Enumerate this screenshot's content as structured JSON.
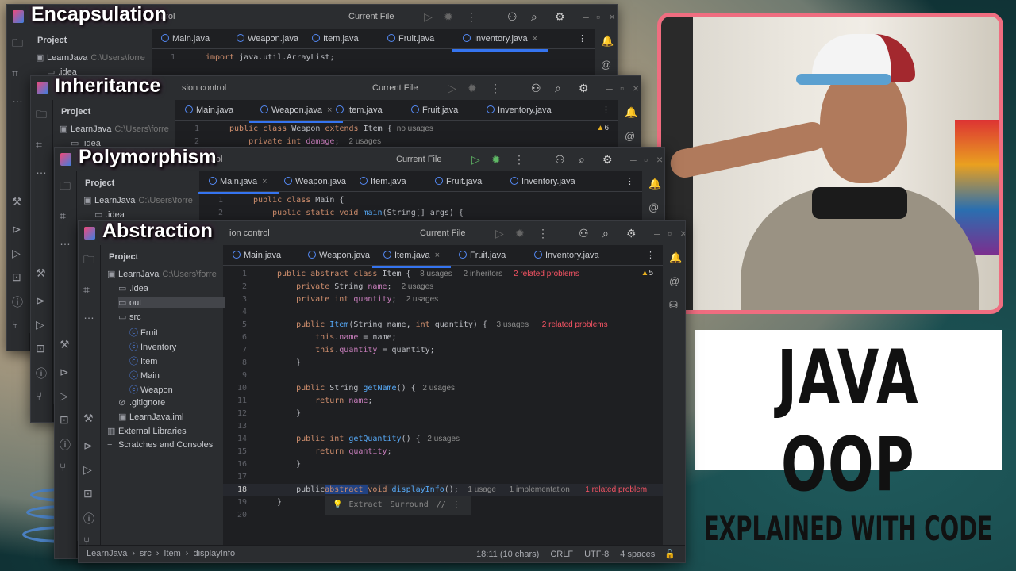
{
  "windows": [
    {
      "label": "Encapsulation",
      "vcs": "ntrol",
      "run_config": "Current File",
      "tabs": [
        "Main.java",
        "Weapon.java",
        "Item.java",
        "Fruit.java",
        "Inventory.java"
      ],
      "active_tab": 4,
      "project_label": "Project",
      "root": "LearnJava",
      "root_path": "C:\\Users\\forre",
      "code": [
        [
          [
            "import ",
            "kw"
          ],
          [
            "java.util.ArrayList;",
            ""
          ]
        ]
      ]
    },
    {
      "label": "Inheritance",
      "vcs": "sion control",
      "run_config": "Current File",
      "tabs": [
        "Main.java",
        "Weapon.java",
        "Item.java",
        "Fruit.java",
        "Inventory.java"
      ],
      "active_tab": 1,
      "project_label": "Project",
      "root": "LearnJava",
      "root_path": "C:\\Users\\forre",
      "warnings": "6",
      "code": [
        [
          [
            "public class ",
            "kw"
          ],
          [
            "Weapon ",
            ""
          ],
          [
            "extends ",
            "kw"
          ],
          [
            "Item { ",
            ""
          ],
          [
            "no usages",
            "hn"
          ]
        ],
        [
          [
            "    private int ",
            "kw"
          ],
          [
            "damage",
            "fd"
          ],
          [
            ";  ",
            ""
          ],
          [
            "2 usages",
            "hn"
          ]
        ]
      ]
    },
    {
      "label": "Polymorphism",
      "vcs": "ntrol",
      "run_config": "Current File",
      "tabs": [
        "Main.java",
        "Weapon.java",
        "Item.java",
        "Fruit.java",
        "Inventory.java"
      ],
      "active_tab": 0,
      "project_label": "Project",
      "root": "LearnJava",
      "root_path": "C:\\Users\\forre",
      "code": [
        [
          [
            "public class ",
            "kw"
          ],
          [
            "Main {",
            ""
          ]
        ],
        [
          [
            "    public static void ",
            "kw"
          ],
          [
            "main",
            "mt"
          ],
          [
            "(String[] args) {",
            ""
          ]
        ]
      ]
    },
    {
      "label": "Abstraction",
      "vcs": "ion control",
      "run_config": "Current File",
      "tabs": [
        "Main.java",
        "Weapon.java",
        "Item.java",
        "Fruit.java",
        "Inventory.java"
      ],
      "active_tab": 2,
      "project_label": "Project",
      "root": "LearnJava",
      "root_path": "C:\\Users\\forre",
      "warnings": "5",
      "code": [
        [
          [
            "public abstract class ",
            "kw"
          ],
          [
            "Item { ",
            ""
          ],
          [
            "  8 usages     2 inheritors     ",
            "hn"
          ],
          [
            "2 related problems",
            "pr"
          ]
        ],
        [
          [
            "    private ",
            "kw"
          ],
          [
            "String ",
            ""
          ],
          [
            "name",
            "fd"
          ],
          [
            ";  ",
            ""
          ],
          [
            "2 usages",
            "hn"
          ]
        ],
        [
          [
            "    private int ",
            "kw"
          ],
          [
            "quantity",
            "fd"
          ],
          [
            ";  ",
            ""
          ],
          [
            "2 usages",
            "hn"
          ]
        ],
        [],
        [
          [
            "    public ",
            "kw"
          ],
          [
            "Item",
            "mt"
          ],
          [
            "(String name, ",
            ""
          ],
          [
            "int ",
            "kw"
          ],
          [
            "quantity) { ",
            ""
          ],
          [
            "  3 usages      ",
            "hn"
          ],
          [
            "2 related problems",
            "pr"
          ]
        ],
        [
          [
            "        this",
            "kw"
          ],
          [
            ".",
            ""
          ],
          [
            "name",
            "fd"
          ],
          [
            " = name;",
            ""
          ]
        ],
        [
          [
            "        this",
            "kw"
          ],
          [
            ".",
            ""
          ],
          [
            "quantity",
            "fd"
          ],
          [
            " = quantity;",
            ""
          ]
        ],
        [
          [
            "    }",
            ""
          ]
        ],
        [],
        [
          [
            "    public ",
            "kw"
          ],
          [
            "String ",
            ""
          ],
          [
            "getName",
            "mt"
          ],
          [
            "() { ",
            ""
          ],
          [
            " 2 usages",
            "hn"
          ]
        ],
        [
          [
            "        return ",
            "kw"
          ],
          [
            "name",
            "fd"
          ],
          [
            ";",
            ""
          ]
        ],
        [
          [
            "    }",
            ""
          ]
        ],
        [],
        [
          [
            "    public int ",
            "kw"
          ],
          [
            "getQuantity",
            "mt"
          ],
          [
            "() { ",
            ""
          ],
          [
            " 2 usages",
            "hn"
          ]
        ],
        [
          [
            "        return ",
            "kw"
          ],
          [
            "quantity",
            "fd"
          ],
          [
            ";",
            ""
          ]
        ],
        [
          [
            "    }",
            ""
          ]
        ],
        [],
        [
          [
            "    public",
            ""
          ],
          [
            "abstract ",
            "kw sel"
          ],
          [
            "void ",
            "kw"
          ],
          [
            "displayInfo",
            "mt"
          ],
          [
            "(); ",
            ""
          ],
          [
            "  1 usage      1 implementation       ",
            "hn"
          ],
          [
            "1 related problem",
            "pr"
          ]
        ],
        [
          [
            "}",
            ""
          ]
        ],
        []
      ],
      "current_line": "18",
      "intention_popup": [
        "Extract",
        "Surround"
      ],
      "tree": [
        {
          "label": "LearnJava",
          "extra": "C:\\Users\\forre",
          "depth": 0,
          "icon": "module-icon",
          "open": true
        },
        {
          "label": ".idea",
          "depth": 1,
          "icon": "folder-icon"
        },
        {
          "label": "out",
          "depth": 1,
          "icon": "folder-icon",
          "selected": true
        },
        {
          "label": "src",
          "depth": 1,
          "icon": "folder-icon",
          "open": true
        },
        {
          "label": "Fruit",
          "depth": 2,
          "icon": "class-icon"
        },
        {
          "label": "Inventory",
          "depth": 2,
          "icon": "class-icon"
        },
        {
          "label": "Item",
          "depth": 2,
          "icon": "class-icon"
        },
        {
          "label": "Main",
          "depth": 2,
          "icon": "class-icon"
        },
        {
          "label": "Weapon",
          "depth": 2,
          "icon": "class-icon"
        },
        {
          "label": ".gitignore",
          "depth": 1,
          "icon": "ignore-icon"
        },
        {
          "label": "LearnJava.iml",
          "depth": 1,
          "icon": "file-icon"
        },
        {
          "label": "External Libraries",
          "depth": 0,
          "icon": "library-icon"
        },
        {
          "label": "Scratches and Consoles",
          "depth": 0,
          "icon": "scratch-icon"
        }
      ],
      "status": {
        "breadcrumb": [
          "LearnJava",
          "src",
          "Item",
          "displayInfo"
        ],
        "position": "18:11 (10 chars)",
        "line_sep": "CRLF",
        "encoding": "UTF-8",
        "indent": "4 spaces"
      }
    }
  ],
  "thumbnail": {
    "title": "JAVA OOP",
    "subtitle": "EXPLAINED WITH CODE",
    "border_color": "#f06d80"
  }
}
